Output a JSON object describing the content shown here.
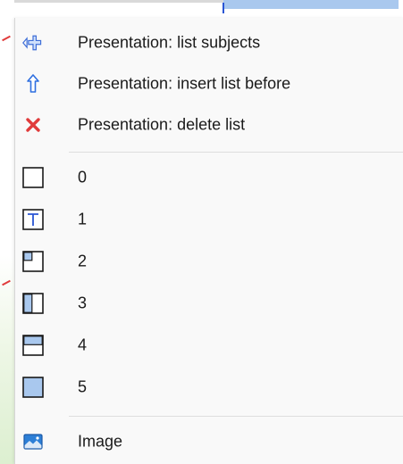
{
  "menu": {
    "commands": [
      {
        "label": "Presentation: list subjects",
        "icon": "list-subjects-icon"
      },
      {
        "label": "Presentation: insert list before",
        "icon": "up-arrow-icon"
      },
      {
        "label": "Presentation: delete list",
        "icon": "delete-x-icon"
      }
    ],
    "layouts": [
      {
        "label": "0",
        "icon": "layout-blank-icon"
      },
      {
        "label": "1",
        "icon": "layout-title-icon"
      },
      {
        "label": "2",
        "icon": "layout-corner-icon"
      },
      {
        "label": "3",
        "icon": "layout-left-panel-icon"
      },
      {
        "label": "4",
        "icon": "layout-top-panel-icon"
      },
      {
        "label": "5",
        "icon": "layout-full-icon"
      }
    ],
    "image": {
      "label": "Image",
      "icon": "image-icon"
    }
  },
  "colors": {
    "accent_blue": "#2a55d4",
    "panel_fill": "#a9c8ee",
    "delete_red": "#e03b3b",
    "menu_bg": "#f9f9f9"
  }
}
